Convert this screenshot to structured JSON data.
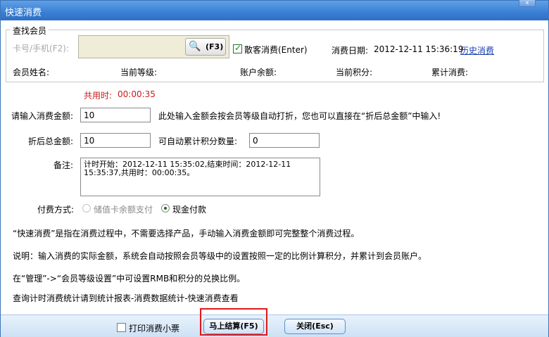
{
  "window": {
    "title": "快速消费",
    "close_label": "x"
  },
  "member_search": {
    "legend": "查找会员",
    "card_placeholder": "卡号/手机(F2):",
    "search_button": "(F3)",
    "guest_label": "散客消费(Enter)",
    "guest_checked": true,
    "date_label": "消费日期:",
    "date_value": "2012-12-11 15:36:19",
    "history_link": "历史消费",
    "member_name_label": "会员姓名:",
    "level_label": "当前等级:",
    "balance_label": "账户余额:",
    "points_label": "当前积分:",
    "total_label": "累计消费:"
  },
  "timer": {
    "label": "共用时:",
    "value": "00:00:35"
  },
  "form": {
    "amount_label": "请输入消费金额:",
    "amount_value": "10",
    "amount_hint": "此处输入金额会按会员等级自动打折，您也可以直接在“折后总金额”中输入!",
    "discount_label": "折后总金额:",
    "discount_value": "10",
    "points_label": "可自动累计积分数量:",
    "points_value": "0",
    "note_label": "备注:",
    "note_value": "计时开始：2012-12-11 15:35:02,结束时间：2012-12-11\n15:35:37,共用时：00:00:35。",
    "payment_label": "付费方式:",
    "payment_options": [
      "储值卡余额支付",
      "现金付款"
    ],
    "payment_selected": "现金付款"
  },
  "info": {
    "line1": "“快速消费”是指在消费过程中，不需要选择产品，手动输入消费金额即可完整整个消费过程。",
    "line2": "说明：输入消费的实际金额，系统会自动按照会员等级中的设置按照一定的比例计算积分，并累计到会员账户。",
    "line3": "在“管理”->“会员等级设置”中可设置RMB和积分的兑换比例。",
    "line4": "查询计时消费统计请到统计报表-消费数据统计-快速消费查看"
  },
  "footer": {
    "print_label": "打印消费小票",
    "print_checked": false,
    "checkout_button": "马上结算(F5)",
    "close_button": "关闭(Esc)"
  },
  "colors": {
    "titlebar": "#3a7fd4",
    "highlight": "#e01818",
    "timer": "#c91a1a",
    "link": "#1a3fb0"
  }
}
